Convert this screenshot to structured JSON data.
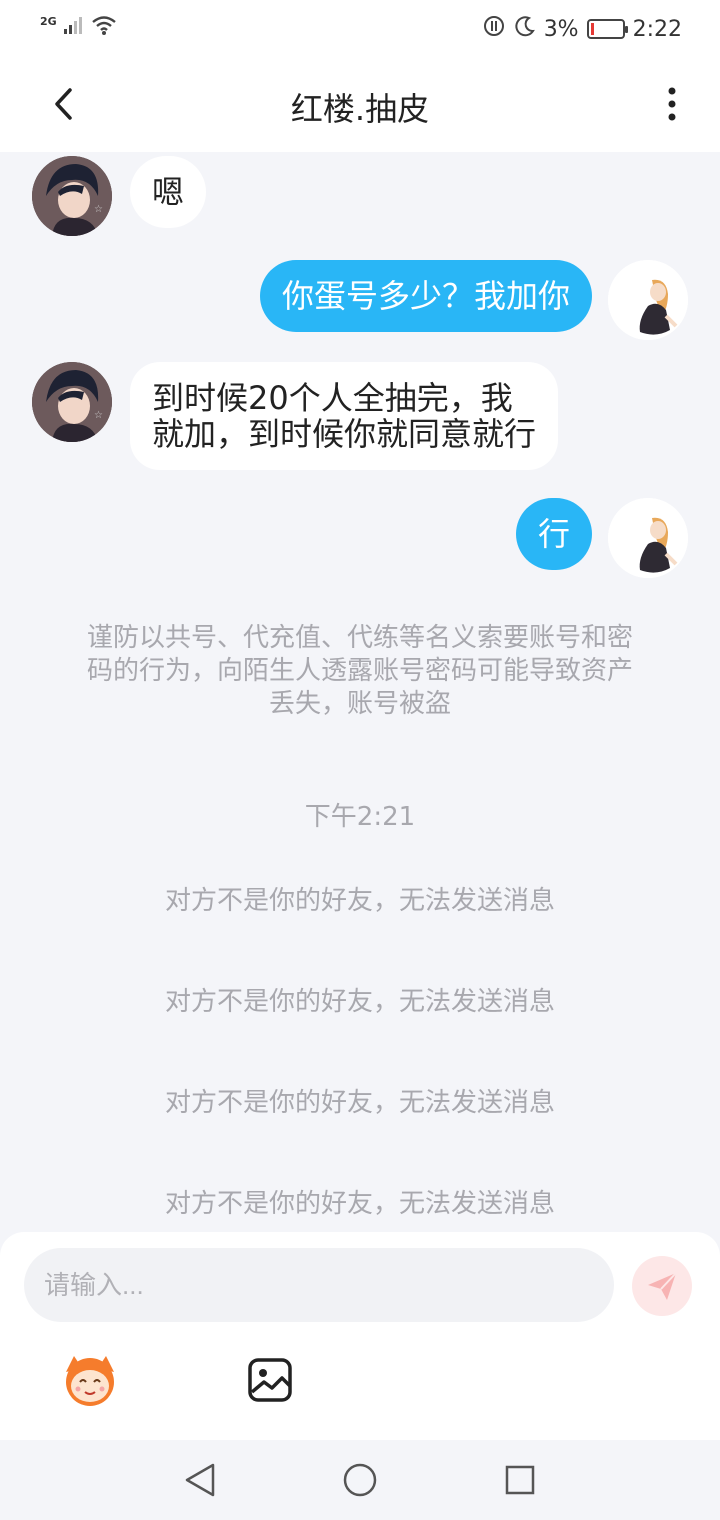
{
  "status_bar": {
    "network": "2G",
    "battery_percent": "3%",
    "time": "2:22",
    "icons": [
      "signal-icon",
      "wifi-icon",
      "data-saver-icon",
      "moon-icon",
      "battery-icon"
    ]
  },
  "header": {
    "title": "红楼.抽皮",
    "back_icon": "chevron-left-icon",
    "more_icon": "more-vertical-icon"
  },
  "messages": [
    {
      "from": "other",
      "text": "嗯"
    },
    {
      "from": "me",
      "text": "你蛋号多少？我加你"
    },
    {
      "from": "other",
      "line1": "到时候20个人全抽完，我",
      "line2": "就加，到时候你就同意就行"
    },
    {
      "from": "me",
      "text": "行"
    }
  ],
  "notice": {
    "line1": "谨防以共号、代充值、代练等名义索要账号和密",
    "line2": "码的行为，向陌生人透露账号密码可能导致资产",
    "line3": "丢失，账号被盗"
  },
  "timestamp": "下午2:21",
  "system_messages": [
    "对方不是你的好友，无法发送消息",
    "对方不是你的好友，无法发送消息",
    "对方不是你的好友，无法发送消息",
    "对方不是你的好友，无法发送消息"
  ],
  "composer": {
    "placeholder": "请输入...",
    "send_icon": "send-icon",
    "emoji_icon": "emoji-mascot-icon",
    "image_icon": "image-icon"
  },
  "nav_bar": {
    "icons": [
      "nav-back-icon",
      "nav-home-icon",
      "nav-recents-icon"
    ]
  },
  "colors": {
    "bubble_out": "#29b6f6",
    "bubble_in": "#ffffff",
    "background": "#f4f5f9",
    "system_text": "#a8a8ae"
  }
}
